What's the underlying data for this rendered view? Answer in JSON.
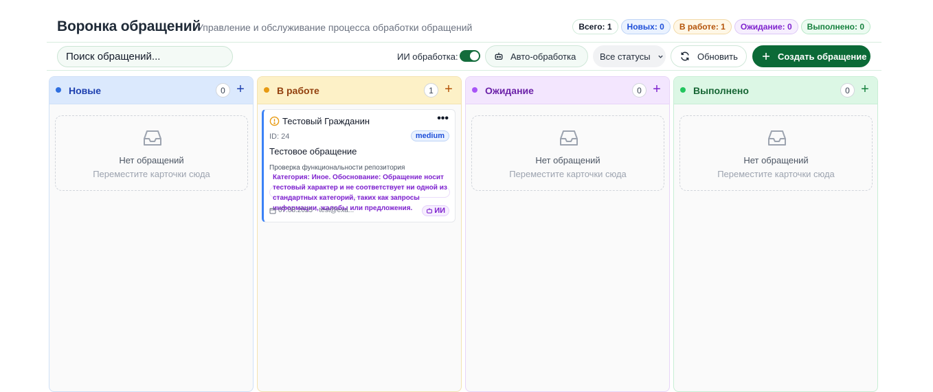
{
  "header": {
    "title": "Воронка обращений",
    "subtitle": "Управление и обслуживание процесса обработки обращений",
    "stats": {
      "total": "Всего: 1",
      "new": "Новых: 0",
      "in_work": "В работе: 1",
      "waiting": "Ожидание: 0",
      "done": "Выполнено: 0"
    }
  },
  "toolbar": {
    "search_placeholder": "Поиск обращений...",
    "ai_label": "ИИ обработка:",
    "ai_enabled": true,
    "auto_button": "Авто-обработка",
    "status_filter": "Все статусы",
    "refresh_button": "Обновить",
    "create_button": "Создать обращение"
  },
  "columns": [
    {
      "title": "Новые",
      "count": "0",
      "add": "+",
      "color": "#2f6fe0"
    },
    {
      "title": "В работе",
      "count": "1",
      "add": "+",
      "color": "#e79a12"
    },
    {
      "title": "Ожидание",
      "count": "0",
      "add": "+",
      "color": "#a855f7"
    },
    {
      "title": "Выполнено",
      "count": "0",
      "add": "+",
      "color": "#22c55e"
    }
  ],
  "empty_state": {
    "title": "Нет обращений",
    "hint": "Переместите карточки сюда",
    "icon": "inbox-tray-icon"
  },
  "card": {
    "citizen": "Тестовый Гражданин",
    "more": "•••",
    "id": "ID: 24",
    "priority": "medium",
    "subject": "Тестовое обращение",
    "description": "Проверка функциональности репозитория",
    "ai_text": "Категория: Иное. Обоснование: Обращение носит тестовый характер и не соответствует ни одной из стандартных категорий, таких как запросы информации, жалобы или предложения.",
    "date": "07.08.2025",
    "email": "test@exa...",
    "ai_badge": "ИИ",
    "accent": "#3b82f6"
  }
}
